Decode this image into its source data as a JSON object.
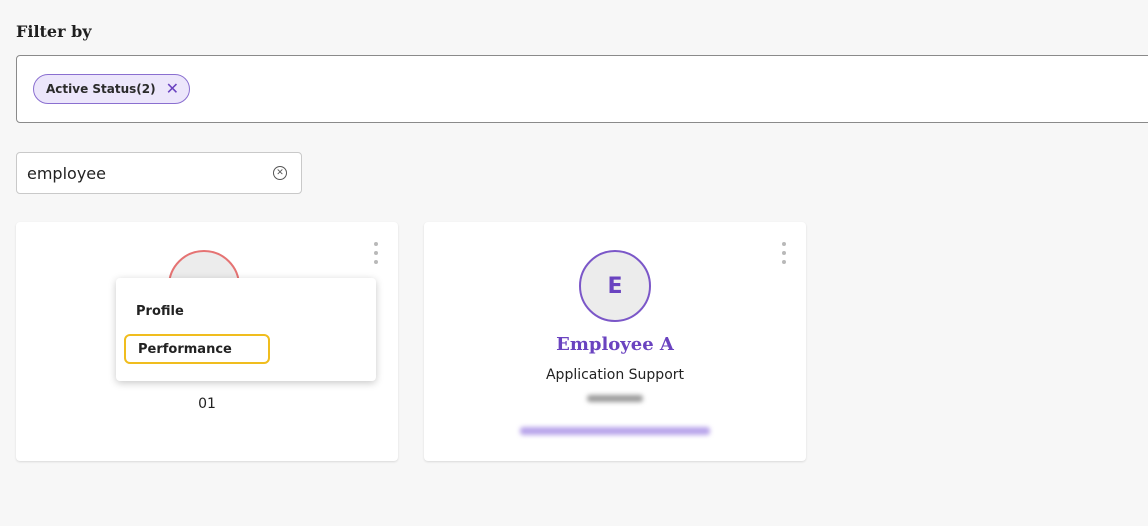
{
  "filter": {
    "label": "Filter by",
    "chips": [
      {
        "label": "Active Status(2)",
        "remove_icon": "close-icon"
      }
    ]
  },
  "search": {
    "value": "employee",
    "clear_icon": "circle-x-icon"
  },
  "cards": [
    {
      "id_text": "01",
      "avatar_ring_color": "#e57373",
      "menu": {
        "items": [
          {
            "label": "Profile"
          },
          {
            "label": "Performance",
            "highlighted": true
          }
        ]
      }
    },
    {
      "avatar_letter": "E",
      "name": "Employee A",
      "role": "Application Support",
      "avatar_ring_color": "#7b57c8"
    }
  ],
  "colors": {
    "accent": "#6a43c0",
    "chip_bg": "#ece6fb",
    "highlight": "#f0bd1e"
  }
}
